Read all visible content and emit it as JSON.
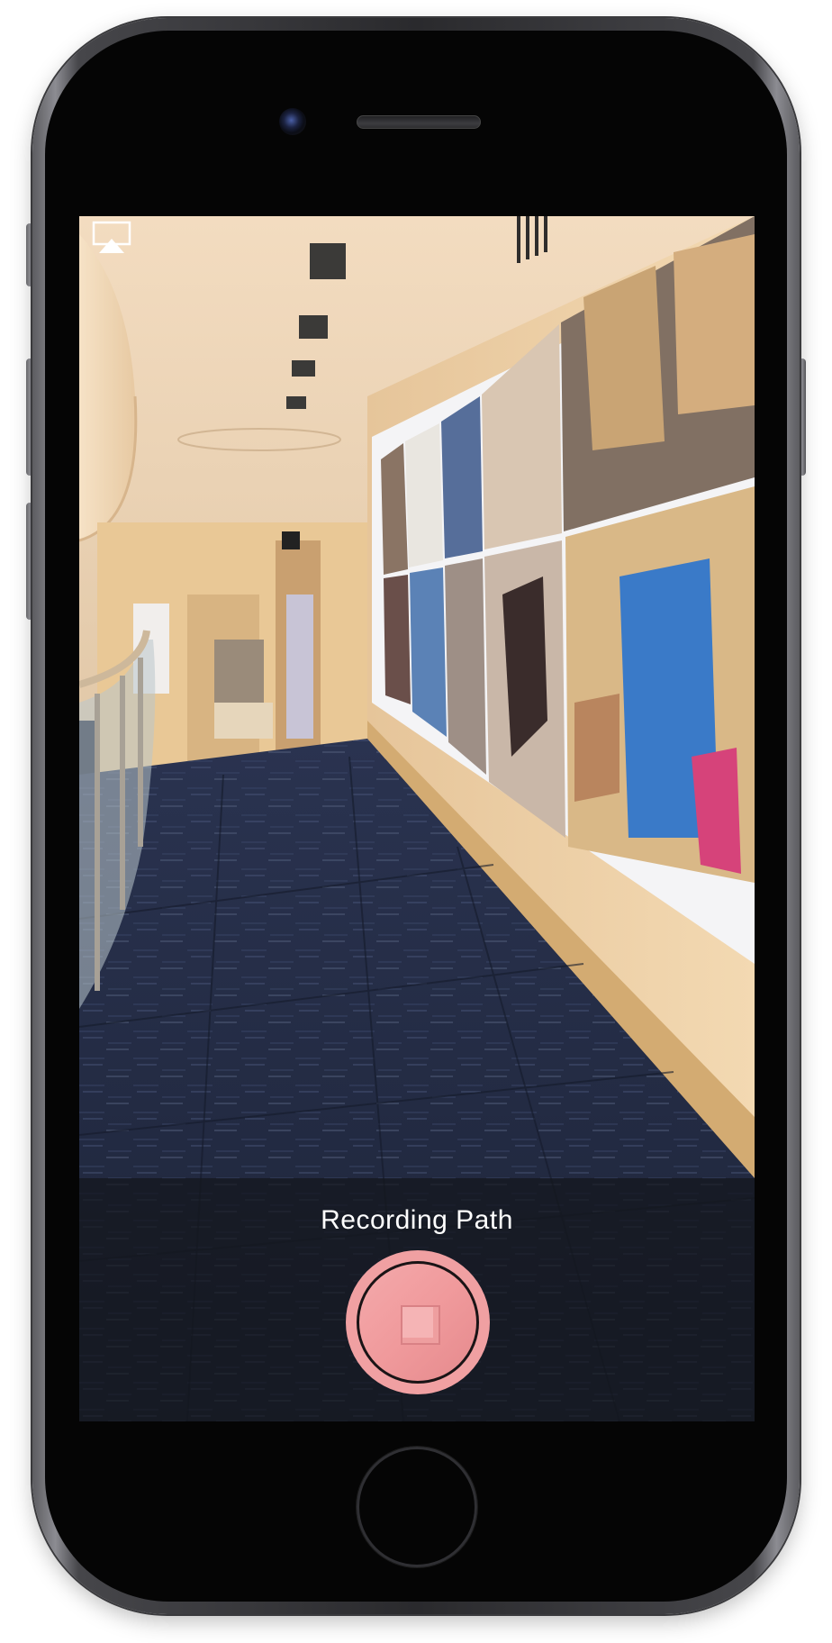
{
  "screen": {
    "status_label": "Recording Path",
    "airplay_icon": "airplay-icon",
    "stop_button_icon": "stop-square-icon"
  },
  "colors": {
    "record_button": "#f0a0a2",
    "panel_overlay": "#14161c",
    "label_text": "#ffffff"
  }
}
